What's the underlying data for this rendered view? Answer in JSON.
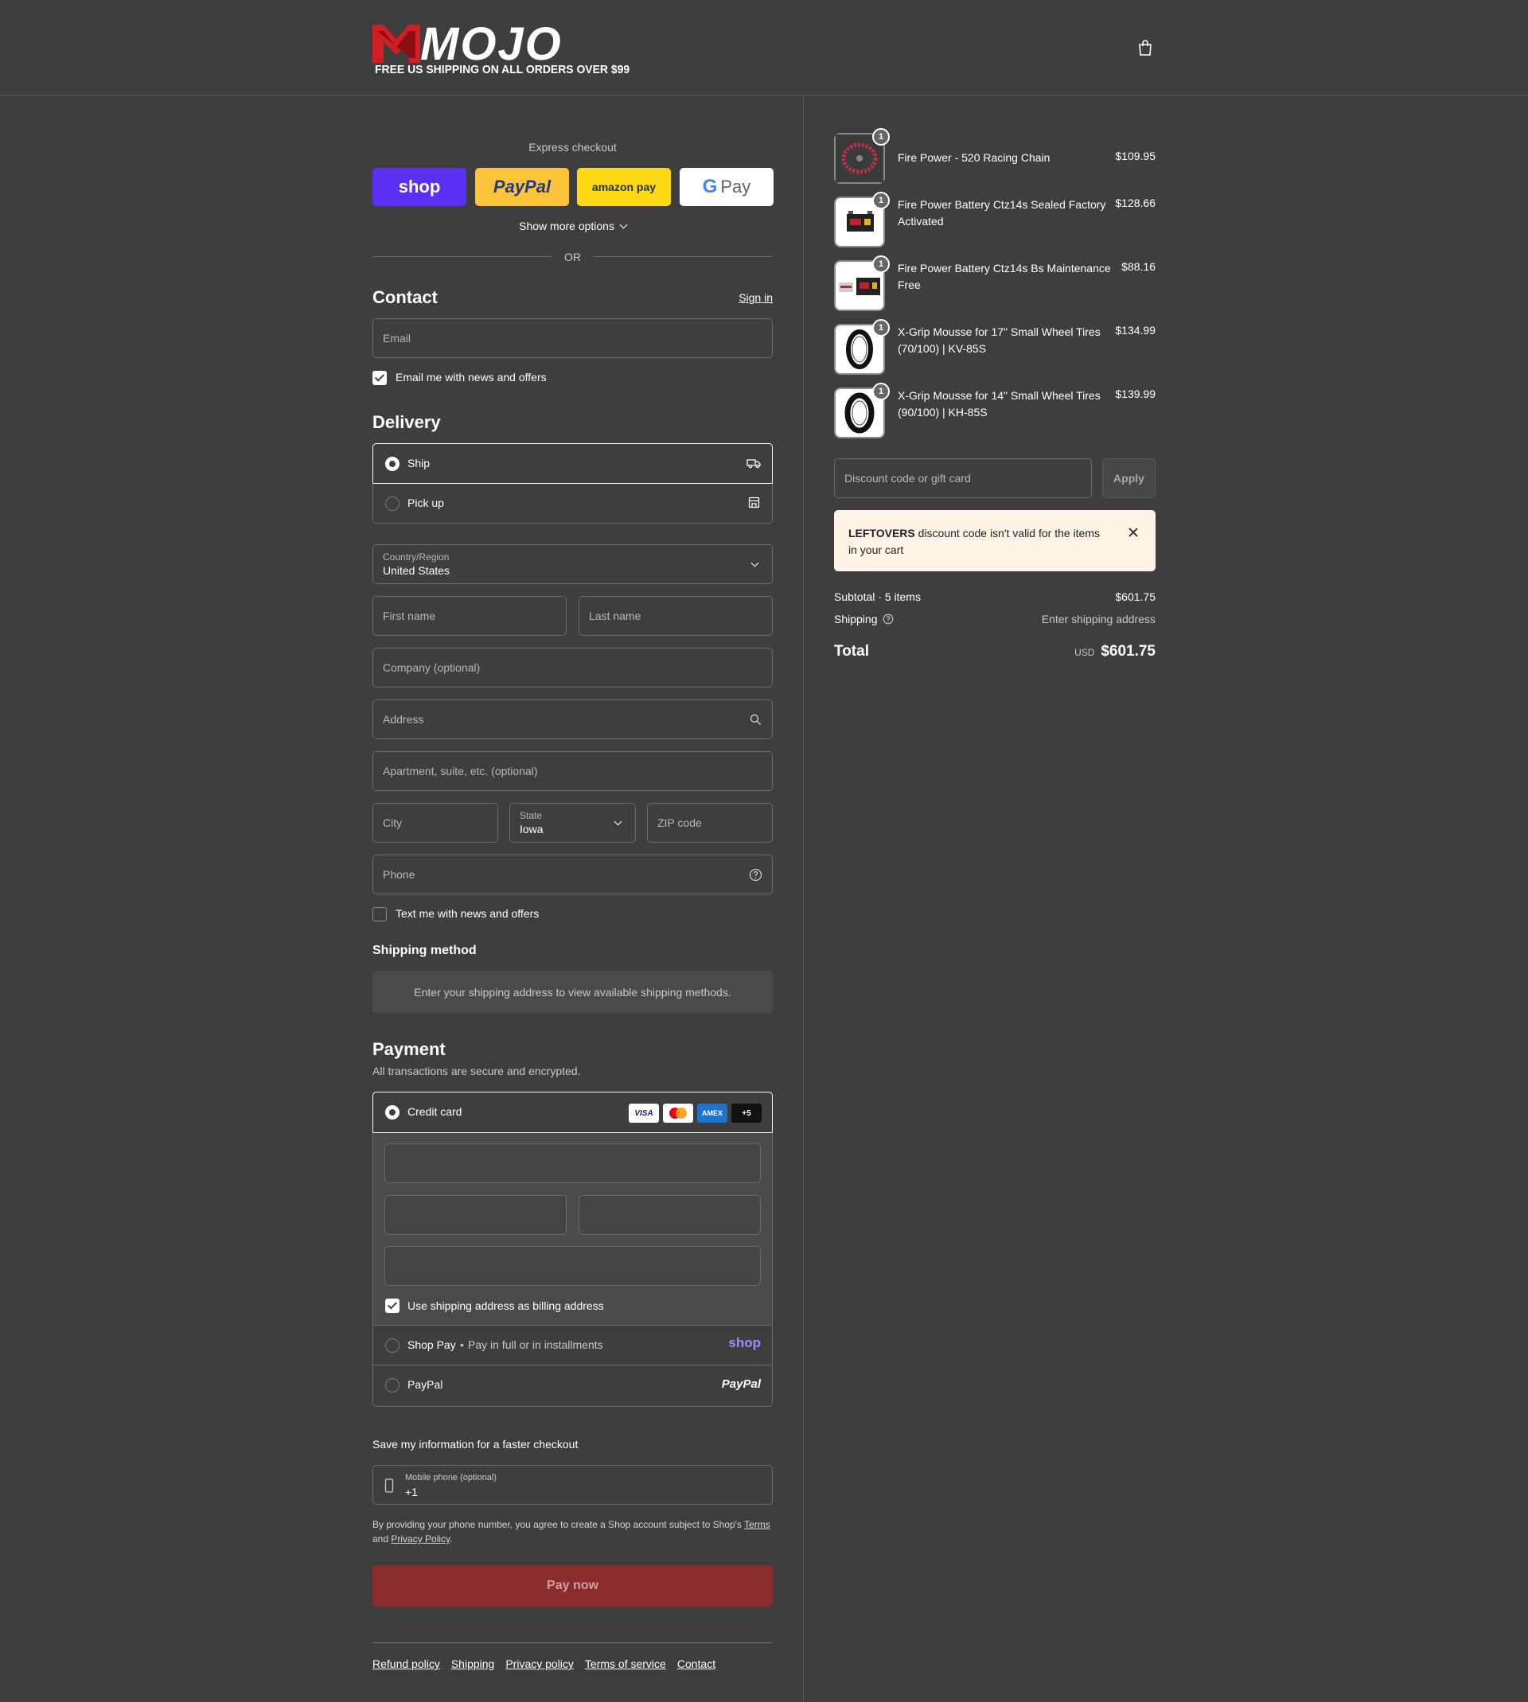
{
  "header": {
    "logo_text": "MOJO",
    "logo_tagline": "FREE US SHIPPING ON ALL ORDERS OVER $99",
    "cart_icon": "shopping-bag-icon"
  },
  "express": {
    "title": "Express checkout",
    "shop_label": "shop",
    "paypal_label": "PayPal",
    "amazon_label": "amazon pay",
    "gpay_label": "Pay",
    "show_more": "Show more options",
    "or": "OR"
  },
  "contact": {
    "title": "Contact",
    "sign_in": "Sign in",
    "email_placeholder": "Email",
    "newsletter_label": "Email me with news and offers",
    "newsletter_checked": true
  },
  "delivery": {
    "title": "Delivery",
    "options": [
      {
        "label": "Ship",
        "selected": true,
        "icon": "truck-icon"
      },
      {
        "label": "Pick up",
        "selected": false,
        "icon": "store-icon"
      }
    ],
    "country_label": "Country/Region",
    "country_value": "United States",
    "first_name": "First name",
    "last_name": "Last name",
    "company": "Company (optional)",
    "address": "Address",
    "apartment": "Apartment, suite, etc. (optional)",
    "city": "City",
    "state_label": "State",
    "state_value": "Iowa",
    "zip": "ZIP code",
    "phone": "Phone",
    "sms_label": "Text me with news and offers",
    "sms_checked": false
  },
  "shipping_method": {
    "title": "Shipping method",
    "message": "Enter your shipping address to view available shipping methods."
  },
  "payment": {
    "title": "Payment",
    "subtitle": "All transactions are secure and encrypted.",
    "credit_card_label": "Credit card",
    "card_logos": [
      "VISA",
      "Mastercard",
      "AMEX",
      "+5"
    ],
    "billing_same_label": "Use shipping address as billing address",
    "billing_same_checked": true,
    "shop_pay_label": "Shop Pay",
    "shop_pay_sub": "Pay in full or in installments",
    "shop_pay_logo": "shop",
    "paypal_label": "PayPal",
    "paypal_logo": "PayPal"
  },
  "save_info": {
    "title": "Save my information for a faster checkout",
    "phone_label": "Mobile phone (optional)",
    "phone_value": "+1",
    "legal_prefix": "By providing your phone number, you agree to create a Shop account subject to Shop's",
    "terms_link": "Terms",
    "and": "and",
    "privacy_link": "Privacy Policy",
    "period": "."
  },
  "pay_button": "Pay now",
  "footer_links": [
    "Refund policy",
    "Shipping",
    "Privacy policy",
    "Terms of service",
    "Contact"
  ],
  "summary": {
    "items": [
      {
        "name": "Fire Power - 520 Racing Chain",
        "price": "$109.95",
        "qty": "1"
      },
      {
        "name": "Fire Power Battery Ctz14s Sealed Factory Activated",
        "price": "$128.66",
        "qty": "1"
      },
      {
        "name": "Fire Power Battery Ctz14s Bs Maintenance Free",
        "price": "$88.16",
        "qty": "1"
      },
      {
        "name": "X-Grip Mousse for 17\" Small Wheel Tires (70/100) | KV-85S",
        "price": "$134.99",
        "qty": "1"
      },
      {
        "name": "X-Grip Mousse for 14\" Small Wheel Tires (90/100) | KH-85S",
        "price": "$139.99",
        "qty": "1"
      }
    ],
    "discount_placeholder": "Discount code or gift card",
    "apply": "Apply",
    "alert_code": "LEFTOVERS",
    "alert_text": "discount code isn't valid for the items in your cart",
    "subtotal_label": "Subtotal · 5 items",
    "subtotal_value": "$601.75",
    "shipping_label": "Shipping",
    "shipping_value": "Enter shipping address",
    "total_label": "Total",
    "currency": "USD",
    "total_value": "$601.75"
  },
  "colors": {
    "background": "#3e3e3e",
    "pay_button": "#8b2b2b",
    "shop_purple": "#5a31f4",
    "paypal_yellow": "#ffc439",
    "amazon_yellow": "#ffd814",
    "alert_bg": "#fff4e6"
  }
}
